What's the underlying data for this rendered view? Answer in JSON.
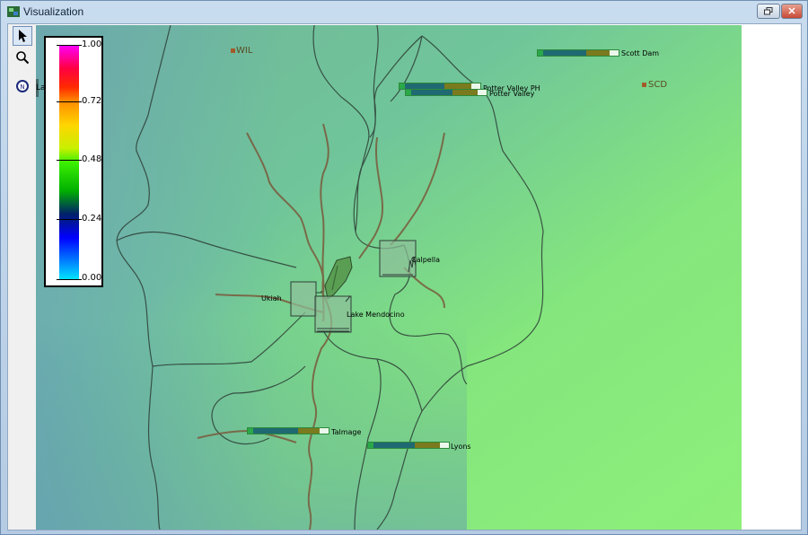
{
  "window": {
    "title": "Visualization"
  },
  "toolbar": {
    "tools": [
      "select-tool",
      "zoom-tool",
      "compass-tool"
    ]
  },
  "legend": {
    "ticks": [
      "1.00",
      "0.72",
      "0.48",
      "0.24",
      "0.00"
    ]
  },
  "sites": {
    "wil": "WIL",
    "scd": "SCD",
    "la": "La"
  },
  "labels": {
    "scott_dam": "Scott Dam",
    "potter_valley_ph": "Potter Valley PH",
    "potter_valley": "Potter Valley",
    "calpella": "Calpella",
    "ukiah": "Ukiah",
    "lake_mendocino": "Lake Mendocino",
    "talmage": "Talmage",
    "lyons": "Lyons"
  },
  "colors": {
    "map_fill": "#7fd48a",
    "boundary": "#2d3e36",
    "river": "#7a5a3c",
    "accent": "#2c8a3a"
  }
}
